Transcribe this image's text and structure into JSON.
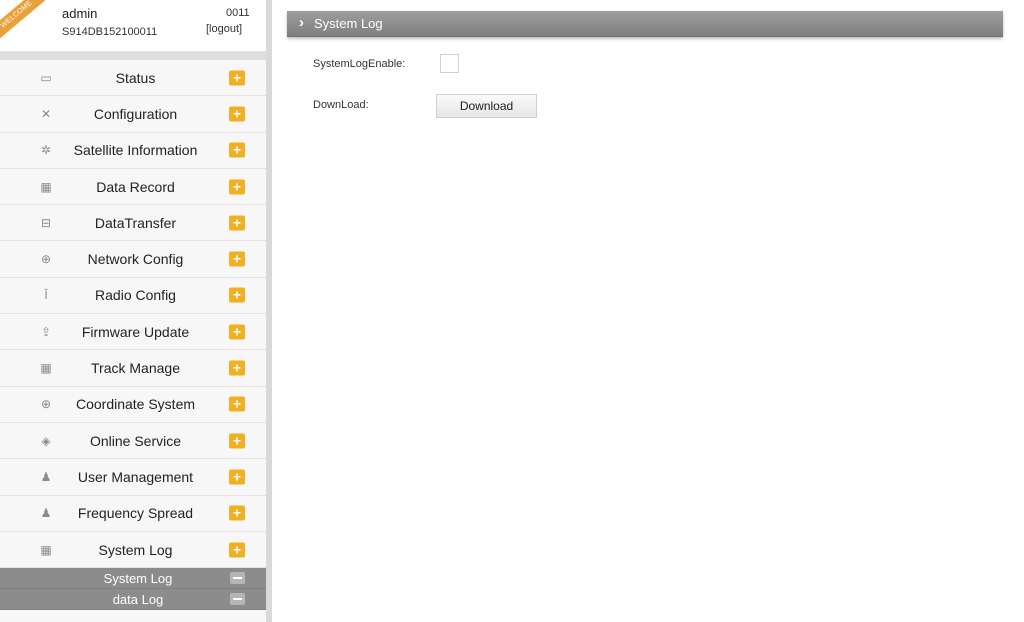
{
  "user": {
    "welcome": "WELCOME",
    "name": "admin",
    "serial": "S914DB152100011",
    "id": "0011",
    "logout": "[logout]"
  },
  "nav": [
    {
      "label": "Status",
      "icon": "monitor-icon",
      "glyph": "▭"
    },
    {
      "label": "Configuration",
      "icon": "tools-icon",
      "glyph": "✕"
    },
    {
      "label": "Satellite Information",
      "icon": "satellite-icon",
      "glyph": "✲"
    },
    {
      "label": "Data Record",
      "icon": "calendar-icon",
      "glyph": "▦"
    },
    {
      "label": "DataTransfer",
      "icon": "network-transfer-icon",
      "glyph": "⊟"
    },
    {
      "label": "Network Config",
      "icon": "globe-icon",
      "glyph": "⊕"
    },
    {
      "label": "Radio Config",
      "icon": "antenna-icon",
      "glyph": "Ῑ"
    },
    {
      "label": "Firmware Update",
      "icon": "upload-icon",
      "glyph": "⇪"
    },
    {
      "label": "Track Manage",
      "icon": "calendar-icon",
      "glyph": "▦"
    },
    {
      "label": "Coordinate System",
      "icon": "globe-icon",
      "glyph": "⊕"
    },
    {
      "label": "Online Service",
      "icon": "cube-icon",
      "glyph": "◈"
    },
    {
      "label": "User Management",
      "icon": "users-icon",
      "glyph": "♟"
    },
    {
      "label": "Frequency Spread",
      "icon": "users-icon",
      "glyph": "♟"
    },
    {
      "label": "System Log",
      "icon": "calendar-icon",
      "glyph": "▦"
    }
  ],
  "subnav": [
    {
      "label": "System Log"
    },
    {
      "label": "data Log"
    }
  ],
  "page": {
    "title": "System Log",
    "log_enable_label": "SystemLogEnable:",
    "log_enable_checked": false,
    "download_label": "DownLoad:",
    "download_button": "Download"
  },
  "colors": {
    "accent": "#f1b021",
    "header": "#8a8a8a",
    "sub_nav": "#8c8c8c"
  }
}
